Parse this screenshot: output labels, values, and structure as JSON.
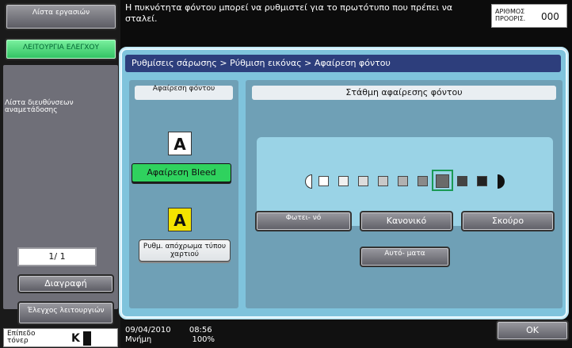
{
  "left": {
    "job_list": "Λίστα εργασιών",
    "check_function": "ΛΕΙΤΟΥΡΓΙΑ ΕΛΕΓΧΟΥ",
    "address_list": "Λίστα διευθύνσεων αναμετάδοσης",
    "page": "1/ 1",
    "delete": "Διαγραφή",
    "check_functions": "Έλεγχος λειτουργιών",
    "toner_label": "Επίπεδο τόνερ",
    "toner_value": "K"
  },
  "header": {
    "message": "Η πυκνότητα φόντου μπορεί να ρυθμιστεί για το πρωτότυπο που πρέπει να σταλεί.",
    "copies_label": "ΑΡΙΘΜΟΣ ΠΡΟΟΡΙΣ.",
    "copies_value": "000"
  },
  "breadcrumb": "Ρυθμίσεις σάρωσης > Ρύθμιση εικόνας > Αφαίρεση φόντου",
  "left_panel": {
    "title": "Αφαίρεση φόντου",
    "bleed_button": "Αφαίρεση Bleed",
    "paper_color_button": "Ρυθμ. απόχρωμα τύπου χαρτιού",
    "sample_glyph": "A"
  },
  "right_panel": {
    "title": "Στάθμη αφαίρεσης φόντου",
    "light_button": "Φωτει- νό",
    "normal_button": "Κανονικό",
    "dark_button": "Σκούρο",
    "auto_button": "Αυτό- ματα"
  },
  "footer": {
    "date": "09/04/2010",
    "time": "08:56",
    "memory_label": "Μνήμη",
    "memory_value": "100%",
    "ok": "OK"
  },
  "scale": {
    "level_count": 9,
    "selected_index": 6,
    "colors": [
      "#ffffff",
      "#f0f0f0",
      "#dcdcdc",
      "#c8c8c8",
      "#b0b0b0",
      "#8a8a8a",
      "#6a6a6a",
      "#444444",
      "#222222"
    ]
  }
}
